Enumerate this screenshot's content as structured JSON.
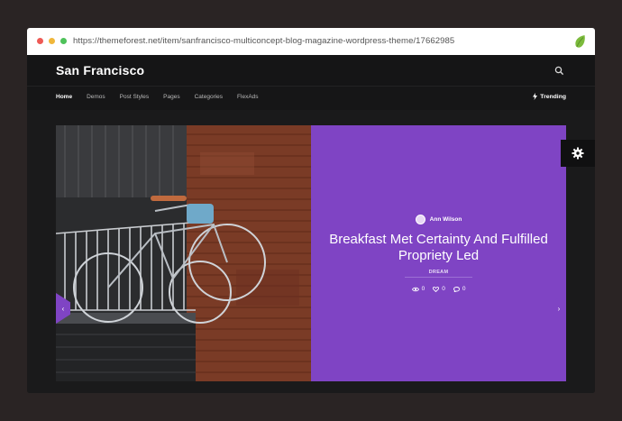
{
  "browser": {
    "url": "https://themeforest.net/item/sanfrancisco-multiconcept-blog-magazine-wordpress-theme/17662985"
  },
  "site": {
    "logo": "San Francisco",
    "nav": [
      "Home",
      "Demos",
      "Post Styles",
      "Pages",
      "Categories",
      "FlexAds"
    ],
    "active_nav": "Home",
    "trending": "Trending"
  },
  "hero": {
    "author": "Ann Wilson",
    "title": "Breakfast Met Certainty And Fulfilled Propriety Led",
    "category": "DREAM",
    "views": "0",
    "likes": "0",
    "comments": "0"
  },
  "colors": {
    "accent": "#7f44c4",
    "background": "#2a2424"
  },
  "icons": [
    "search-icon",
    "bolt-icon",
    "gear-icon",
    "chevron-left-icon",
    "chevron-right-icon",
    "eye-icon",
    "heart-icon",
    "comment-icon",
    "envato-leaf-icon"
  ]
}
